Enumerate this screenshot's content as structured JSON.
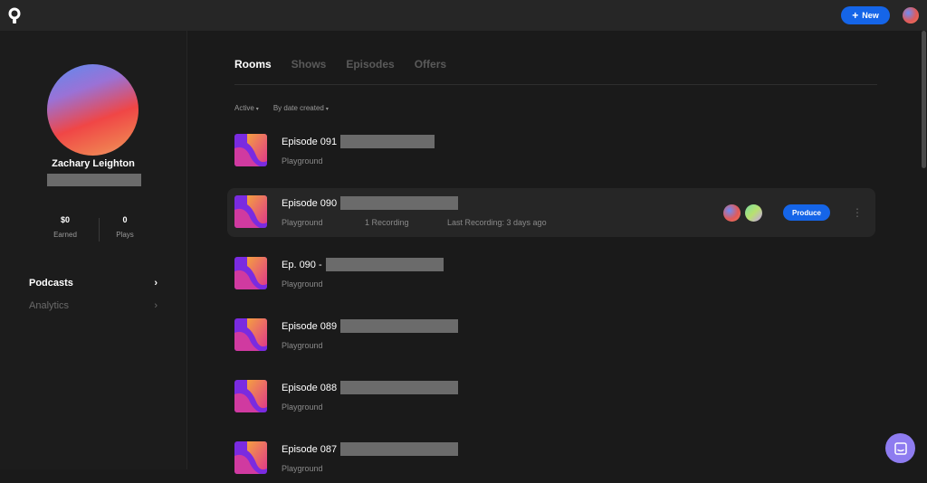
{
  "header": {
    "new_label": "New",
    "new_icon": "plus-icon",
    "accent_color": "#1565e8"
  },
  "profile": {
    "name": "Zachary Leighton",
    "stats": [
      {
        "value": "$0",
        "label": "Earned"
      },
      {
        "value": "0",
        "label": "Plays"
      }
    ]
  },
  "sidebar": {
    "items": [
      {
        "label": "Podcasts",
        "chevron": "›",
        "active": true
      },
      {
        "label": "Analytics",
        "chevron": "›",
        "active": false
      }
    ]
  },
  "tabs": [
    {
      "label": "Rooms",
      "active": true
    },
    {
      "label": "Shows",
      "active": false
    },
    {
      "label": "Episodes",
      "active": false
    },
    {
      "label": "Offers",
      "active": false
    }
  ],
  "filters": {
    "status": "Active",
    "sort": "By date created",
    "caret": "▾"
  },
  "rooms": [
    {
      "title": "Episode 091",
      "subtitle": "Playground",
      "recordings": "",
      "last_recording": ""
    },
    {
      "title": "Episode 090",
      "subtitle": "Playground",
      "recordings": "1 Recording",
      "last_recording": "Last Recording: 3 days ago",
      "produce_label": "Produce",
      "more_icon": "⋮"
    },
    {
      "title": "Ep. 090 -",
      "subtitle": "Playground",
      "recordings": "",
      "last_recording": ""
    },
    {
      "title": "Episode 089",
      "subtitle": "Playground",
      "recordings": "",
      "last_recording": ""
    },
    {
      "title": "Episode 088",
      "subtitle": "Playground",
      "recordings": "",
      "last_recording": ""
    },
    {
      "title": "Episode 087",
      "subtitle": "Playground",
      "recordings": "",
      "last_recording": ""
    }
  ]
}
